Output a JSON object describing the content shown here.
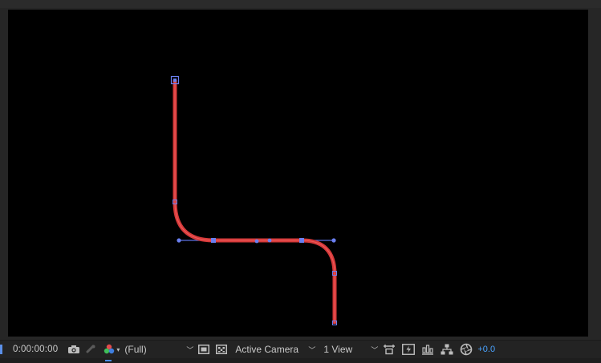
{
  "viewer": {
    "background_color": "#000000",
    "path_color": "#e03c3c",
    "handle_color": "#5a6fe0"
  },
  "toolbar": {
    "timecode": "0:00:00:00",
    "resolution": "(Full)",
    "camera": "Active Camera",
    "view_layout": "1 View",
    "exposure": "+0.0",
    "icons": [
      "snapshot-icon",
      "show-snapshot-icon",
      "color-channels-icon",
      "region-of-interest-icon",
      "transparency-grid-icon",
      "fast-previews-icon",
      "reset-exposure-icon",
      "flowchart-icon",
      "3d-renderer-icon",
      "exposure-icon"
    ]
  }
}
